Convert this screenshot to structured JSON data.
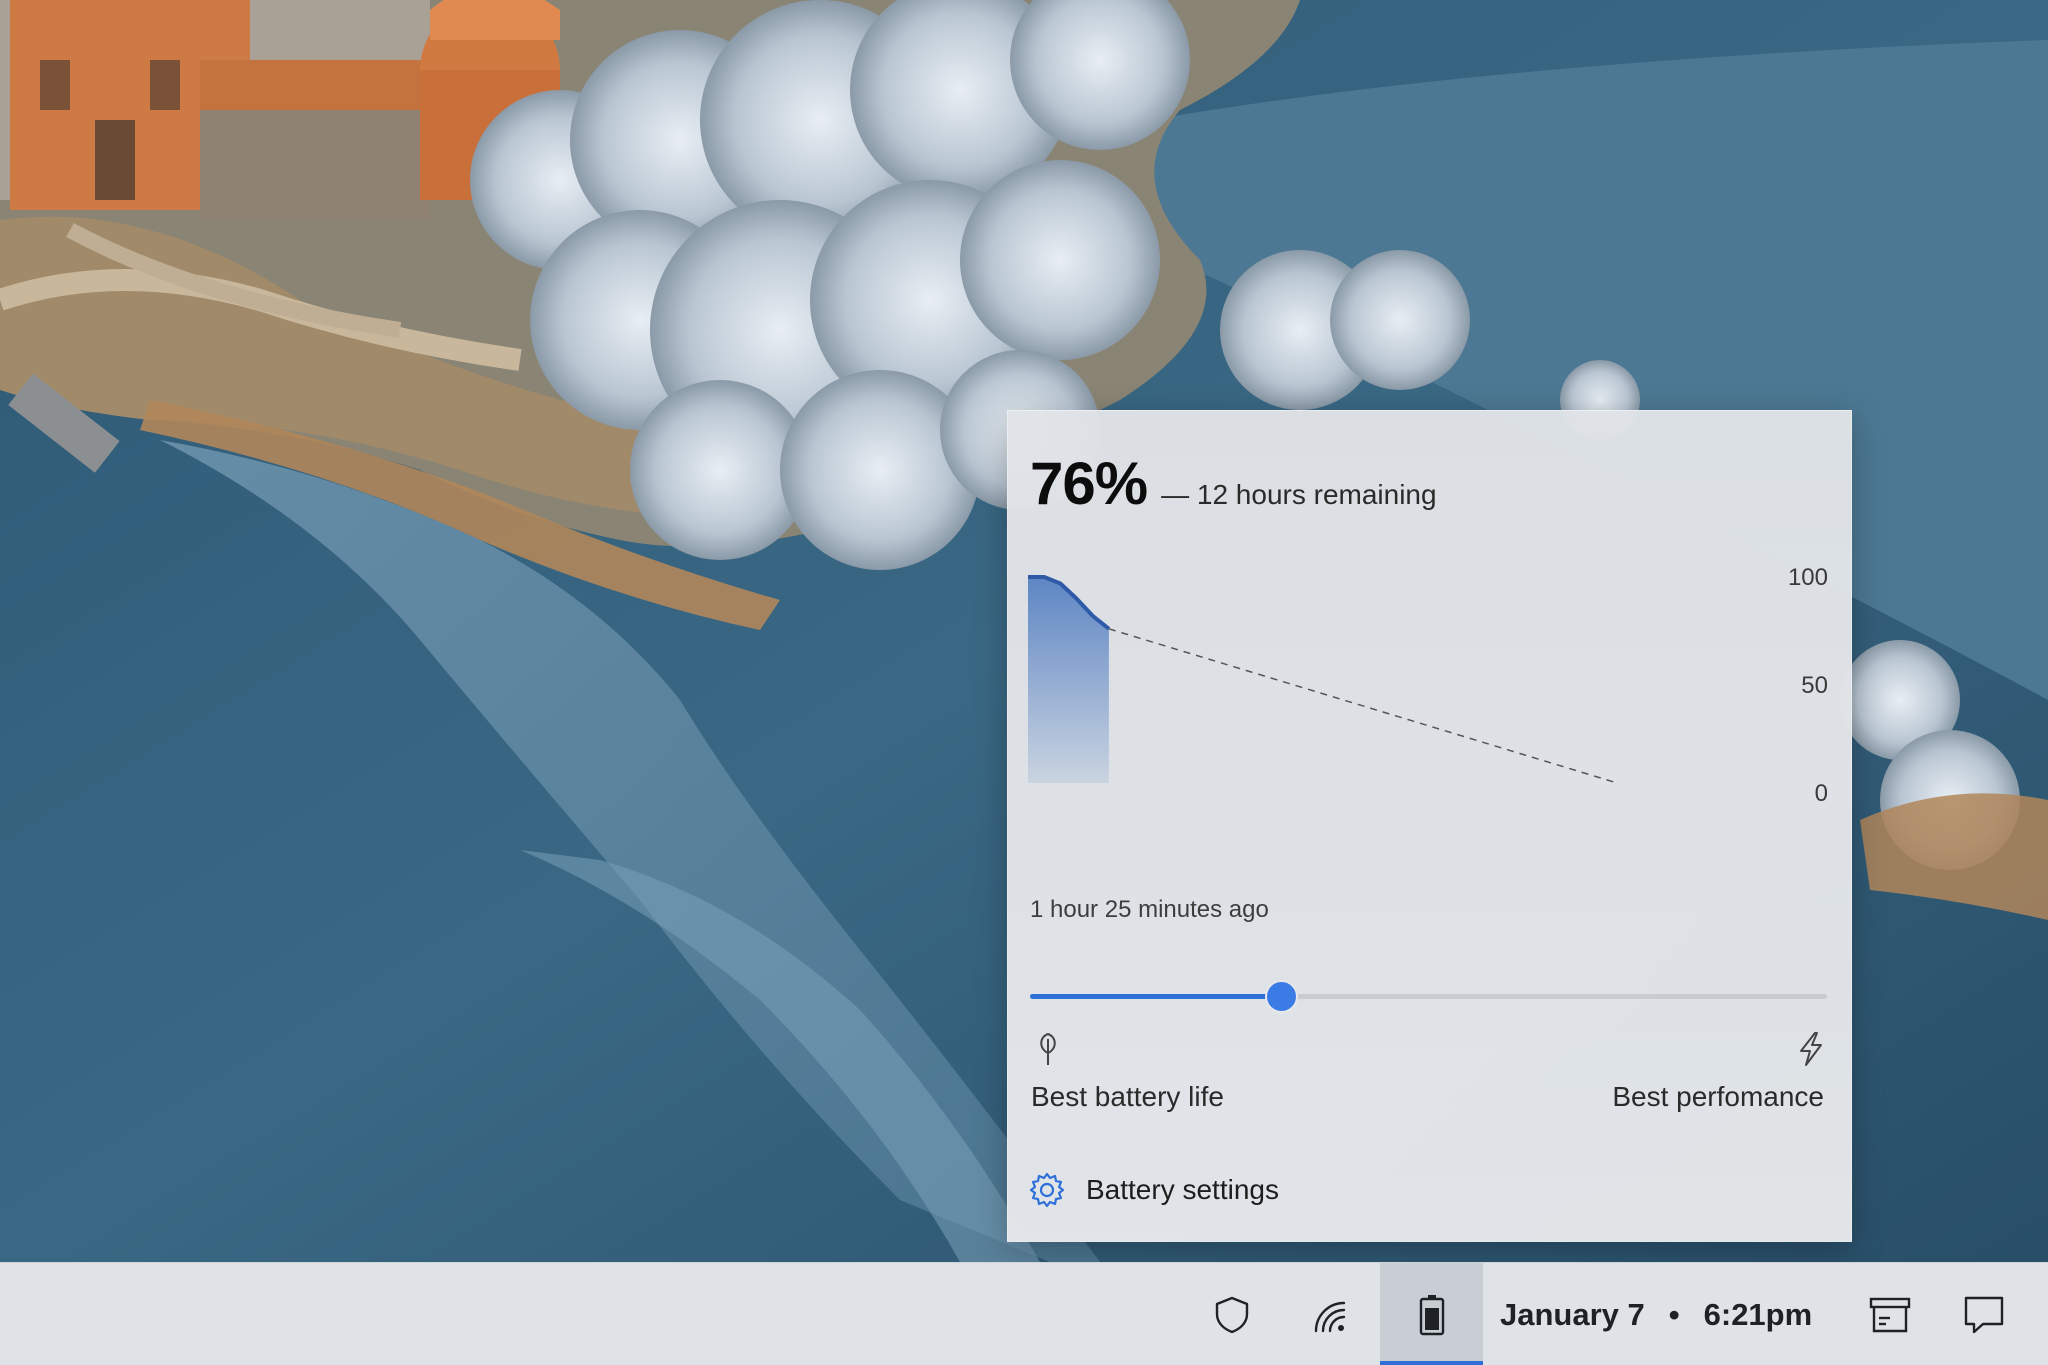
{
  "battery_flyout": {
    "percent": "76%",
    "remaining": "— 12 hours remaining",
    "history_label": "1 hour 25 minutes ago",
    "power_mode_position": 0.315,
    "power_mode_min_label": "Best battery life",
    "power_mode_max_label": "Best perfomance",
    "settings_label": "Battery settings",
    "icons": [
      "leaf-icon",
      "lightning-bolt-icon",
      "gear-icon"
    ]
  },
  "chart_data": {
    "type": "area",
    "title": "",
    "xlabel": "",
    "ylabel": "",
    "ylim": [
      0,
      100
    ],
    "yticks": [
      "100",
      "50",
      "0"
    ],
    "history": {
      "x": [
        0,
        0.2,
        0.4,
        0.6,
        0.8,
        1.0
      ],
      "values": [
        100,
        100,
        97,
        90,
        82,
        76
      ]
    },
    "projection": {
      "x": [
        1.0,
        7.25
      ],
      "values": [
        76,
        5
      ]
    },
    "fill_color": "#5d86c4",
    "line_color": "#2f5aa8"
  },
  "taskbar": {
    "date": "January 7",
    "separator": "•",
    "time": "6:21pm",
    "icons": [
      "shield-icon",
      "wifi-icon",
      "battery-icon",
      "news-icon",
      "notification-icon"
    ]
  },
  "colors": {
    "accent": "#2f6fd8",
    "flyout_bg": "#e3e5e8",
    "taskbar_bg": "#dfe3e8"
  }
}
